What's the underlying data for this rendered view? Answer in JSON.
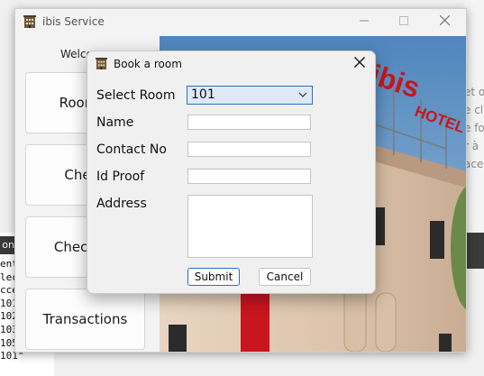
{
  "background": {
    "editor_bar_label": "on",
    "editor_lines": [
      "ent_",
      "lec",
      "cce",
      "101",
      "102",
      "103",
      "105\"",
      "101\""
    ],
    "right_text_lines": [
      "et o",
      "e cl",
      "e fo",
      "r à",
      "acer"
    ]
  },
  "window": {
    "title": "ibis Service",
    "welcome": "Welco",
    "buttons": [
      "Room B",
      "Check",
      "Check Av",
      "Transactions"
    ],
    "hotel_sign": "ibis",
    "hotel_sub": "HOTEL"
  },
  "dialog": {
    "title": "Book a room",
    "labels": {
      "select_room": "Select Room",
      "name": "Name",
      "contact": "Contact No",
      "id_proof": "Id Proof",
      "address": "Address"
    },
    "fields": {
      "room": "101",
      "name": "",
      "contact": "",
      "id_proof": "",
      "address": ""
    },
    "submit_label": "Submit",
    "cancel_label": "Cancel"
  },
  "colors": {
    "accent": "#2a6fbd",
    "brand_red": "#c9151e"
  }
}
